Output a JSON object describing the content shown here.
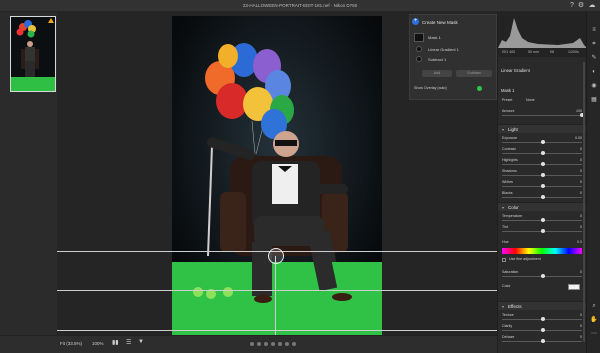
{
  "window": {
    "title": "23-HALLOWEEN-PORTRAIT-EDIT-181.nef  ·  Nikon D750"
  },
  "masks_panel": {
    "title": "Create New Mask",
    "items": [
      "Mask 1",
      "Linear Gradient 1",
      "Subtract 1"
    ],
    "add_label": "Add",
    "subtract_label": "Subtract",
    "overlay_label": "Show Overlay (auto)"
  },
  "histogram": {
    "iso": "ISO 400",
    "focal": "50 mm",
    "aperture": "f/8",
    "shutter": "1/200s"
  },
  "right_panel": {
    "tool_title": "Linear Gradient",
    "mask_name": "Mask 1",
    "preset_label": "Preset",
    "preset_value": "None",
    "amount_label": "Amount",
    "amount_value": "100",
    "light_title": "Light",
    "color_title": "Color",
    "effects_title": "Effects",
    "light": [
      {
        "name": "Exposure",
        "value": "0.00"
      },
      {
        "name": "Contrast",
        "value": "0"
      },
      {
        "name": "Highlights",
        "value": "0"
      },
      {
        "name": "Shadows",
        "value": "0"
      },
      {
        "name": "Whites",
        "value": "0"
      },
      {
        "name": "Blacks",
        "value": "0"
      }
    ],
    "color": [
      {
        "name": "Temperature",
        "value": "0"
      },
      {
        "name": "Tint",
        "value": "0"
      }
    ],
    "hue_label": "Hue",
    "hue_value": "0.0",
    "fine_label": "Use fine adjustment",
    "saturation_label": "Saturation",
    "saturation_value": "0",
    "color_swatch_label": "Color",
    "effects": [
      {
        "name": "Texture",
        "value": "0"
      },
      {
        "name": "Clarity",
        "value": "0"
      },
      {
        "name": "Dehaze",
        "value": "0"
      }
    ]
  },
  "bottom_bar": {
    "zoom_fit": "Fit (33.5%)",
    "zoom_100": "100%"
  }
}
